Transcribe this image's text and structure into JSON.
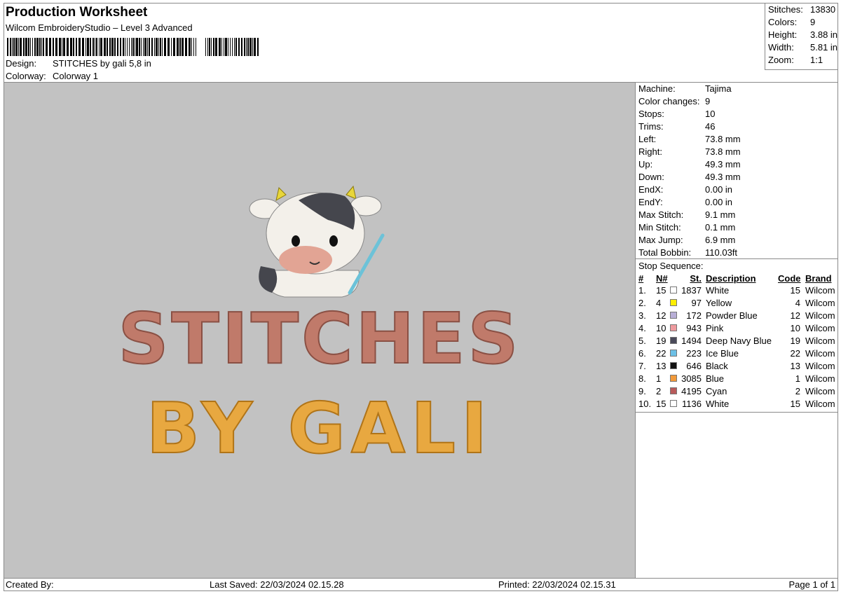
{
  "header": {
    "title": "Production Worksheet",
    "software": "Wilcom EmbroideryStudio – Level 3 Advanced",
    "design_label": "Design:",
    "design_value": "STITCHES by gali 5,8 in",
    "colorway_label": "Colorway:",
    "colorway_value": "Colorway 1"
  },
  "summary": {
    "stitches_label": "Stitches:",
    "stitches_value": "13830",
    "colors_label": "Colors:",
    "colors_value": "9",
    "height_label": "Height:",
    "height_value": "3.88 in",
    "width_label": "Width:",
    "width_value": "5.81 in",
    "zoom_label": "Zoom:",
    "zoom_value": "1:1"
  },
  "design_preview": {
    "line1": "STITCHES",
    "line2": "BY GALI",
    "colors": {
      "canvas": "#c2c2c2",
      "line1": "#c07a6a",
      "line2": "#e8a840",
      "cow_body": "#f3f0ea",
      "cow_spot": "#45464d",
      "cow_nose": "#e2a494",
      "hook": "#6cc2d8",
      "horn": "#e8d63a"
    }
  },
  "machine": {
    "rows": [
      {
        "label": "Machine:",
        "value": "Tajima"
      },
      {
        "label": "Color changes:",
        "value": "9"
      },
      {
        "label": "Stops:",
        "value": "10"
      },
      {
        "label": "Trims:",
        "value": "46"
      },
      {
        "label": "Left:",
        "value": "73.8 mm"
      },
      {
        "label": "Right:",
        "value": "73.8 mm"
      },
      {
        "label": "Up:",
        "value": "49.3 mm"
      },
      {
        "label": "Down:",
        "value": "49.3 mm"
      },
      {
        "label": "EndX:",
        "value": "0.00 in"
      },
      {
        "label": "EndY:",
        "value": "0.00 in"
      },
      {
        "label": "Max Stitch:",
        "value": "9.1 mm"
      },
      {
        "label": "Min Stitch:",
        "value": "0.1 mm"
      },
      {
        "label": "Max Jump:",
        "value": "6.9 mm"
      },
      {
        "label": "Total Bobbin:",
        "value": "110.03ft"
      }
    ]
  },
  "stop_sequence": {
    "title": "Stop Sequence:",
    "headers": {
      "idx": "#",
      "n": "N#",
      "st": "St.",
      "desc": "Description",
      "code": "Code",
      "brand": "Brand"
    },
    "rows": [
      {
        "idx": "1.",
        "n": "15",
        "color": "#ffffff",
        "st": "1837",
        "desc": "White",
        "code": "15",
        "brand": "Wilcom"
      },
      {
        "idx": "2.",
        "n": "4",
        "color": "#ffee00",
        "st": "97",
        "desc": "Yellow",
        "code": "4",
        "brand": "Wilcom"
      },
      {
        "idx": "3.",
        "n": "12",
        "color": "#b8aed6",
        "st": "172",
        "desc": "Powder Blue",
        "code": "12",
        "brand": "Wilcom"
      },
      {
        "idx": "4.",
        "n": "10",
        "color": "#ee9a9e",
        "st": "943",
        "desc": "Pink",
        "code": "10",
        "brand": "Wilcom"
      },
      {
        "idx": "5.",
        "n": "19",
        "color": "#4a4a5a",
        "st": "1494",
        "desc": "Deep Navy Blue",
        "code": "19",
        "brand": "Wilcom"
      },
      {
        "idx": "6.",
        "n": "22",
        "color": "#6cc0e6",
        "st": "223",
        "desc": "Ice Blue",
        "code": "22",
        "brand": "Wilcom"
      },
      {
        "idx": "7.",
        "n": "13",
        "color": "#111111",
        "st": "646",
        "desc": "Black",
        "code": "13",
        "brand": "Wilcom"
      },
      {
        "idx": "8.",
        "n": "1",
        "color": "#f29a3a",
        "st": "3085",
        "desc": "Blue",
        "code": "1",
        "brand": "Wilcom"
      },
      {
        "idx": "9.",
        "n": "2",
        "color": "#b85a5a",
        "st": "4195",
        "desc": "Cyan",
        "code": "2",
        "brand": "Wilcom"
      },
      {
        "idx": "10.",
        "n": "15",
        "color": "#ffffff",
        "st": "1136",
        "desc": "White",
        "code": "15",
        "brand": "Wilcom"
      }
    ]
  },
  "footer": {
    "created_by": "Created By:",
    "last_saved": "Last Saved: 22/03/2024 02.15.28",
    "printed": "Printed: 22/03/2024 02.15.31",
    "page": "Page 1 of 1"
  }
}
